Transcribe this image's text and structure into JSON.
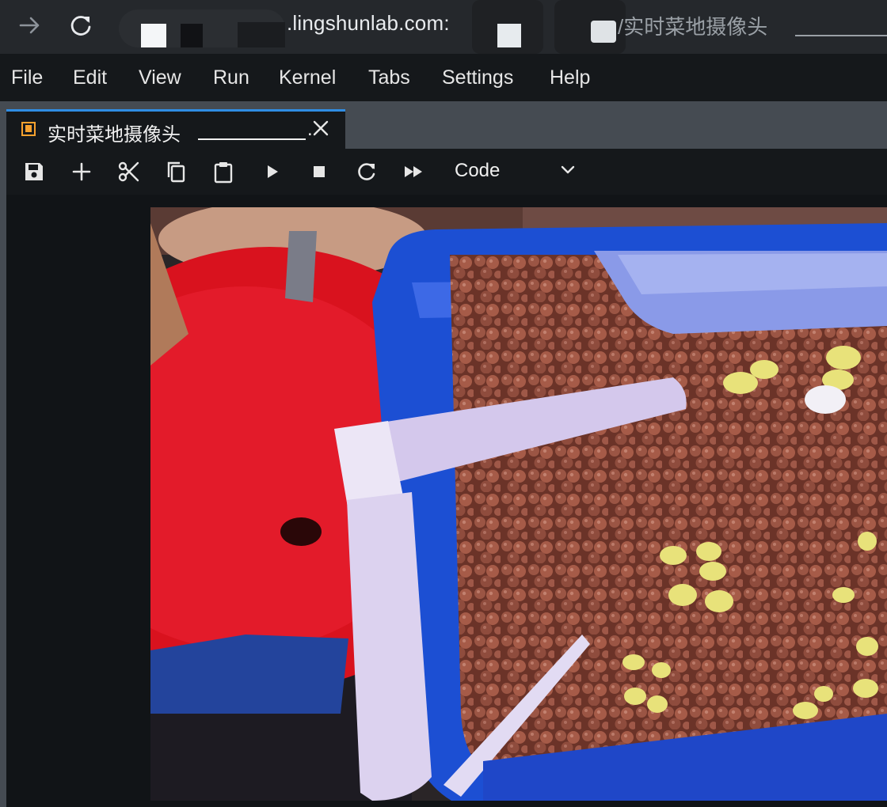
{
  "browser": {
    "url_visible": ".lingshunlab.com:",
    "url_path_visible": "/实时菜地摄像头",
    "back_icon": "arrow-right-icon",
    "reload_icon": "reload-icon"
  },
  "menubar": {
    "items": [
      "File",
      "Edit",
      "View",
      "Run",
      "Kernel",
      "Tabs",
      "Settings",
      "Help"
    ]
  },
  "tab": {
    "title": "实时菜地摄像头",
    "suffix": ".",
    "icon": "notebook-icon",
    "close_icon": "close-icon",
    "accent_color": "#2f8de4"
  },
  "toolbar": {
    "icons": [
      "save-icon",
      "add-icon",
      "cut-icon",
      "copy-icon",
      "paste-icon",
      "run-icon",
      "stop-icon",
      "restart-icon",
      "fast-forward-icon"
    ],
    "cell_type": "Code"
  },
  "output": {
    "image_subject": "camera-feed"
  }
}
